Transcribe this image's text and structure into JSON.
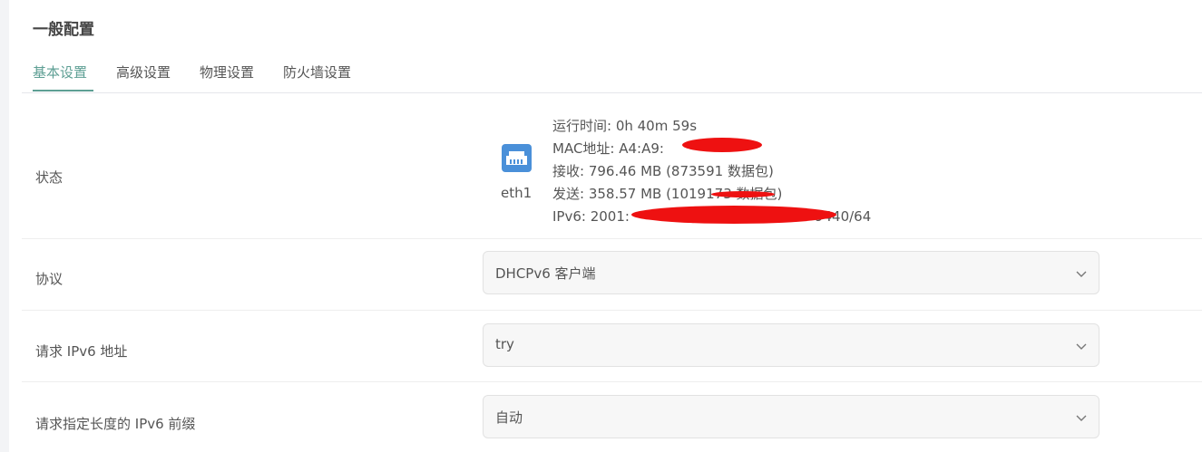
{
  "section": {
    "title": "一般配置"
  },
  "tabs": [
    {
      "label": "基本设置",
      "active": true
    },
    {
      "label": "高级设置",
      "active": false
    },
    {
      "label": "物理设置",
      "active": false
    },
    {
      "label": "防火墙设置",
      "active": false
    }
  ],
  "status": {
    "label": "状态",
    "interface": "eth1",
    "icon": "ethernet-port-icon",
    "uptime": "运行时间: 0h 40m 59s",
    "mac": "MAC地址: A4:A9:",
    "rx": "接收: 796.46 MB (873591 数据包)",
    "tx": "发送: 358.57 MB (1019173 数据包)",
    "ipv6_prefix": "IPv6: 2001:",
    "ipv6_suffix": "9440/64"
  },
  "protocol": {
    "label": "协议",
    "value": "DHCPv6 客户端"
  },
  "request_ipv6": {
    "label": "请求 IPv6 地址",
    "value": "try"
  },
  "prefix_length": {
    "label": "请求指定长度的 IPv6 前缀",
    "value": "自动"
  },
  "colors": {
    "accent": "#5e9f94",
    "icon_blue": "#4a90d9",
    "redaction": "#ee1111"
  }
}
